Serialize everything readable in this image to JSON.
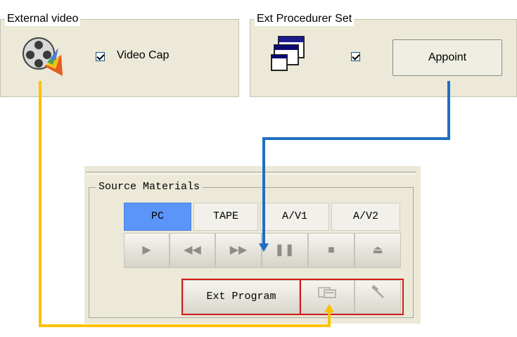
{
  "external_video": {
    "title": "External video",
    "checkbox_label": "Video Cap",
    "checked": true,
    "icon": "film-reel-icon"
  },
  "ext_procedurer": {
    "title": "Ext Procedurer Set",
    "checked": true,
    "appoint_label": "Appoint",
    "icon": "windows-stack-icon"
  },
  "source_materials": {
    "title": "Source Materials",
    "sources": [
      "PC",
      "TAPE",
      "A/V1",
      "A/V2"
    ],
    "selected_source": "PC",
    "transport": [
      "play-icon",
      "rewind-icon",
      "fast-forward-icon",
      "pause-icon",
      "stop-icon",
      "eject-icon"
    ],
    "ext_program_label": "Ext Program",
    "ext_program_icon": "program-launch-icon",
    "settings_icon": "hammer-icon"
  },
  "colors": {
    "arrow_yellow": "#ffc000",
    "arrow_blue": "#1f6fc0",
    "highlight_red": "#d11c1c",
    "selected_blue": "#5b95f9"
  }
}
